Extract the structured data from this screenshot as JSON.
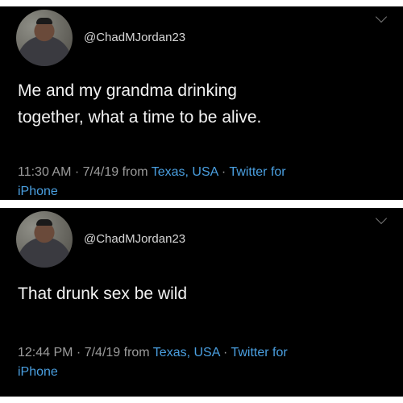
{
  "tweets": [
    {
      "handle": "@ChadMJordan23",
      "text_line1": "Me and my grandma drinking",
      "text_line2": "together, what a time to be alive.",
      "time": "11:30 AM",
      "sep1": " · ",
      "date": "7/4/19 from ",
      "location": "Texas, USA",
      "sep2": " · ",
      "source_part1": "Twitter for",
      "source_part2": "iPhone"
    },
    {
      "handle": "@ChadMJordan23",
      "text_line1": "That drunk sex be wild",
      "time": "12:44 PM",
      "sep1": " · ",
      "date": "7/4/19 from ",
      "location": "Texas, USA",
      "sep2": " · ",
      "source_part1": "Twitter for",
      "source_part2": "iPhone"
    }
  ],
  "colors": {
    "background": "#000000",
    "text": "#f2f2f2",
    "meta": "#9b9b9b",
    "link": "#4a9fe0"
  }
}
